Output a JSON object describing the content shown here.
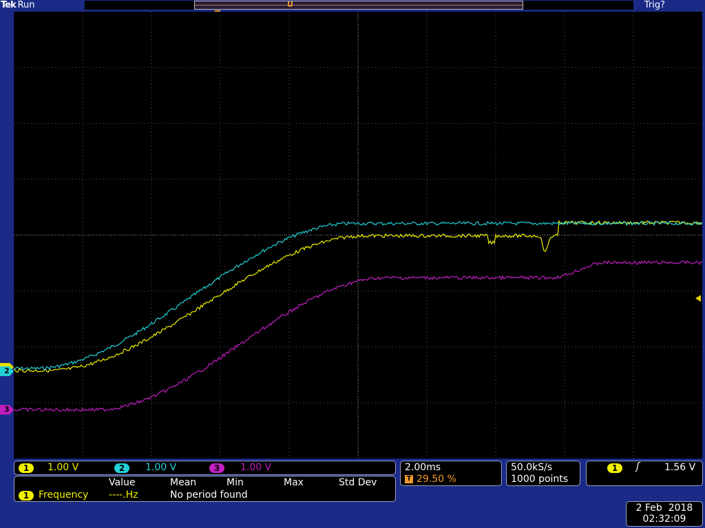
{
  "header": {
    "brand": "Tek",
    "run_state": "Run",
    "trigger_status": "Trig?"
  },
  "markers": {
    "trigger_pos": "T",
    "expansion_point": "U",
    "channel_2": "2",
    "channel_3": "3"
  },
  "channels": [
    {
      "id": "1",
      "scale": "1.00 V",
      "color": "#f0f000"
    },
    {
      "id": "2",
      "scale": "1.00 V",
      "color": "#22d0d8"
    },
    {
      "id": "3",
      "scale": "1.00 V",
      "color": "#c21fc2"
    }
  ],
  "timebase": {
    "horizontal_scale": "2.00ms",
    "trigger_position": "29.50 %",
    "trigger_badge": "T"
  },
  "acquisition": {
    "sample_rate": "50.0kS/s",
    "record_length": "1000 points"
  },
  "trigger": {
    "source": "1",
    "slope_symbol": "ʃ",
    "level": "1.56 V"
  },
  "measurements": {
    "headers": [
      "Value",
      "Mean",
      "Min",
      "Max",
      "Std Dev"
    ],
    "row": {
      "channel": "1",
      "name": "Frequency",
      "value": "----.Hz",
      "status": "No period found"
    }
  },
  "datetime": {
    "date": "2 Feb  2018",
    "time": "02:32:09"
  },
  "colors": {
    "background": "#1a2a86",
    "screen": "#000000",
    "ch1": "#f0f000",
    "ch2": "#22d0d8",
    "ch3": "#c21fc2",
    "trigger": "#f39a2a"
  }
}
